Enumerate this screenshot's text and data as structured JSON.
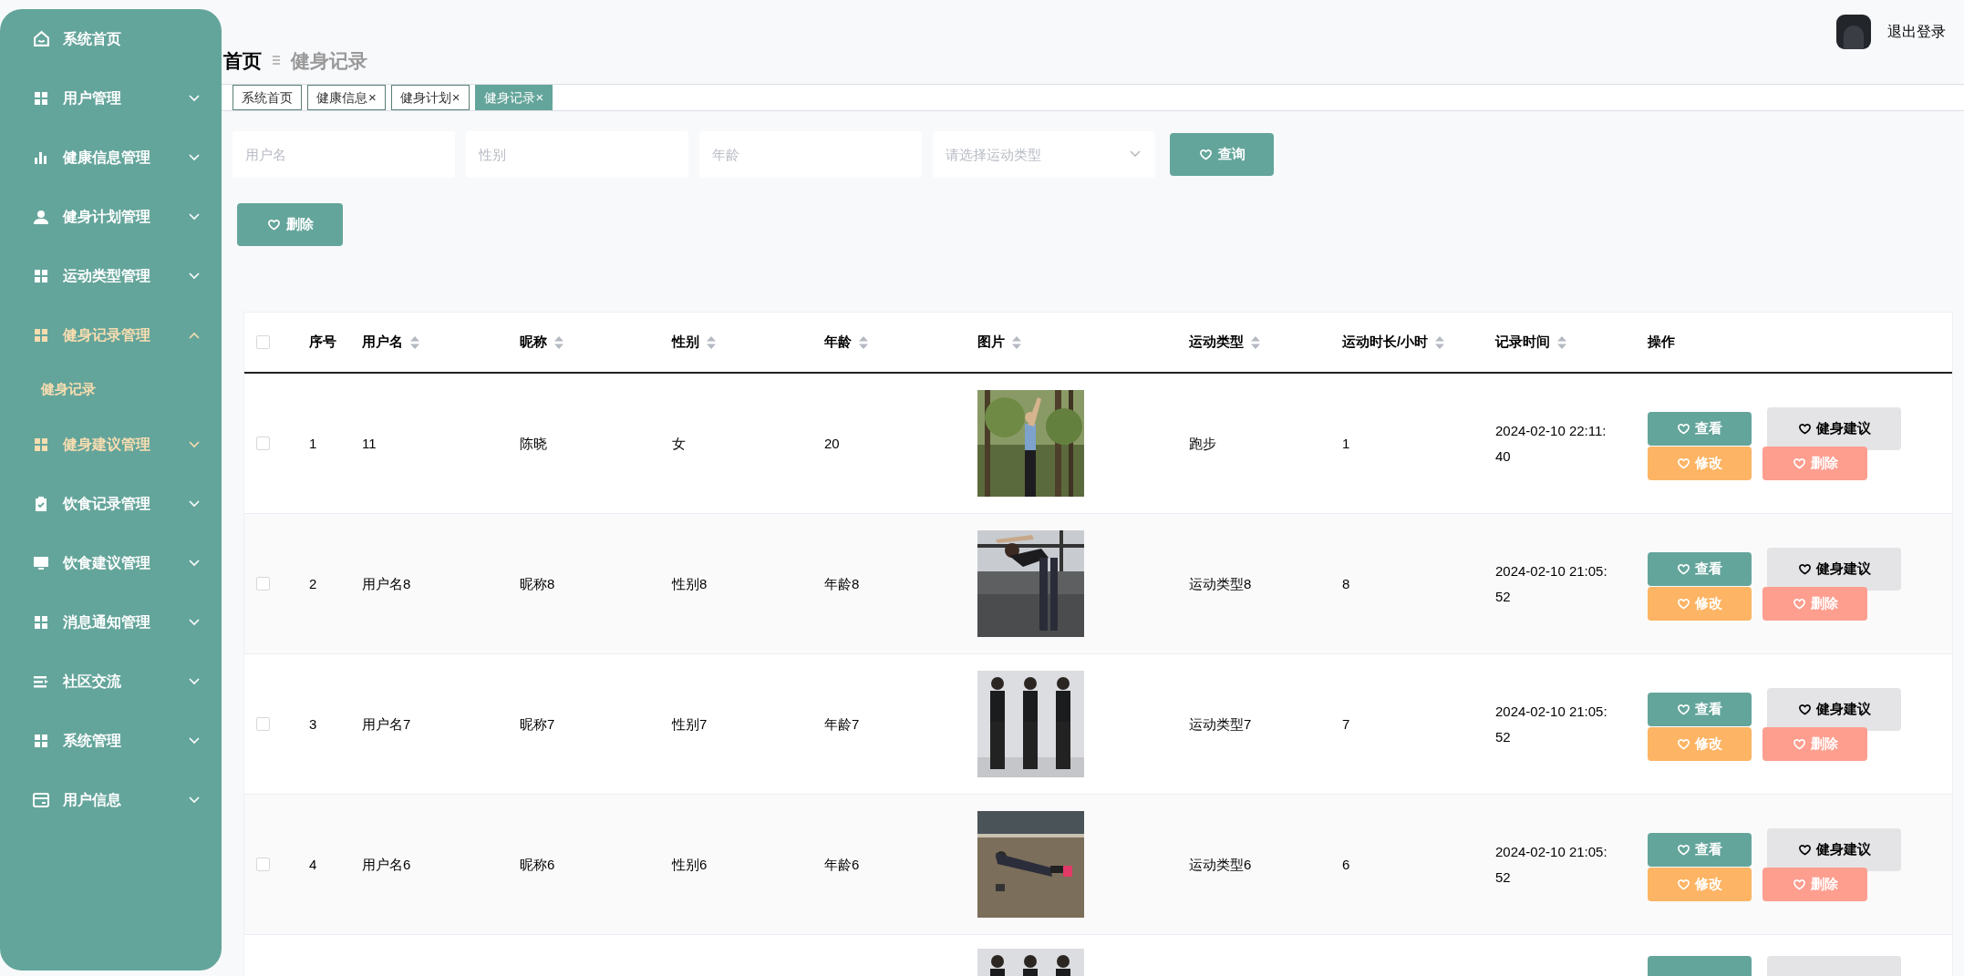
{
  "sidebar": {
    "items": [
      {
        "label": "系统首页",
        "highlighted": false,
        "has_caret": false
      },
      {
        "label": "用户管理",
        "expanded": false,
        "highlighted": false,
        "has_caret": true
      },
      {
        "label": "健康信息管理",
        "expanded": false,
        "highlighted": false,
        "has_caret": true
      },
      {
        "label": "健身计划管理",
        "expanded": false,
        "highlighted": false,
        "has_caret": true
      },
      {
        "label": "运动类型管理",
        "expanded": false,
        "highlighted": false,
        "has_caret": true
      },
      {
        "label": "健身记录管理",
        "expanded": true,
        "highlighted": true,
        "has_caret": true,
        "children": [
          {
            "label": "健身记录",
            "selected": true
          }
        ]
      },
      {
        "label": "健身建议管理",
        "expanded": false,
        "highlighted": true,
        "has_caret": true
      },
      {
        "label": "饮食记录管理",
        "expanded": false,
        "highlighted": false,
        "has_caret": true
      },
      {
        "label": "饮食建议管理",
        "expanded": false,
        "highlighted": false,
        "has_caret": true
      },
      {
        "label": "消息通知管理",
        "expanded": false,
        "highlighted": false,
        "has_caret": true
      },
      {
        "label": "社区交流",
        "expanded": false,
        "highlighted": false,
        "has_caret": true
      },
      {
        "label": "系统管理",
        "expanded": false,
        "highlighted": false,
        "has_caret": true
      },
      {
        "label": "用户信息",
        "expanded": false,
        "highlighted": false,
        "has_caret": true
      }
    ]
  },
  "header": {
    "breadcrumb": [
      "首页",
      "健身记录"
    ],
    "logout": "退出登录"
  },
  "tabs": [
    {
      "label": "系统首页",
      "selected": false
    },
    {
      "label": "健康信息",
      "selected": false,
      "close": "×"
    },
    {
      "label": "健身计划",
      "selected": false,
      "close": "×"
    },
    {
      "label": "健身记录",
      "selected": true,
      "close": "×"
    }
  ],
  "search": {
    "fields": [
      {
        "placeholder": "用户名",
        "kind": "input"
      },
      {
        "placeholder": "性别",
        "kind": "input"
      },
      {
        "placeholder": "年龄",
        "kind": "input"
      },
      {
        "placeholder": "请选择运动类型",
        "kind": "select"
      }
    ],
    "query_button": "查询"
  },
  "delete_button": "删除",
  "table": {
    "all_checked": false,
    "columns": [
      "序号",
      "用户名",
      "昵称",
      "性别",
      "年龄",
      "图片",
      "运动类型",
      "运动时长/小时",
      "记录时间",
      "操作"
    ],
    "rows": [
      {
        "index": "1",
        "username": "11",
        "nickname": "陈晓",
        "gender": "女",
        "age": "20",
        "exercise_type": "跑步",
        "duration": "1",
        "time": "2024-02-10 22:11:40",
        "checked": false,
        "actions": [
          "查看",
          "健身建议",
          "修改",
          "删除"
        ]
      },
      {
        "index": "2",
        "username": "用户名8",
        "nickname": "昵称8",
        "gender": "性别8",
        "age": "年龄8",
        "exercise_type": "运动类型8",
        "duration": "8",
        "time": "2024-02-10 21:05:52",
        "checked": false,
        "actions": [
          "查看",
          "健身建议",
          "修改",
          "删除"
        ]
      },
      {
        "index": "3",
        "username": "用户名7",
        "nickname": "昵称7",
        "gender": "性别7",
        "age": "年龄7",
        "exercise_type": "运动类型7",
        "duration": "7",
        "time": "2024-02-10 21:05:52",
        "checked": false,
        "actions": [
          "查看",
          "健身建议",
          "修改",
          "删除"
        ]
      },
      {
        "index": "4",
        "username": "用户名6",
        "nickname": "昵称6",
        "gender": "性别6",
        "age": "年龄6",
        "exercise_type": "运动类型6",
        "duration": "6",
        "time": "2024-02-10 21:05:52",
        "checked": false,
        "actions": [
          "查看",
          "健身建议",
          "修改",
          "删除"
        ]
      }
    ]
  }
}
